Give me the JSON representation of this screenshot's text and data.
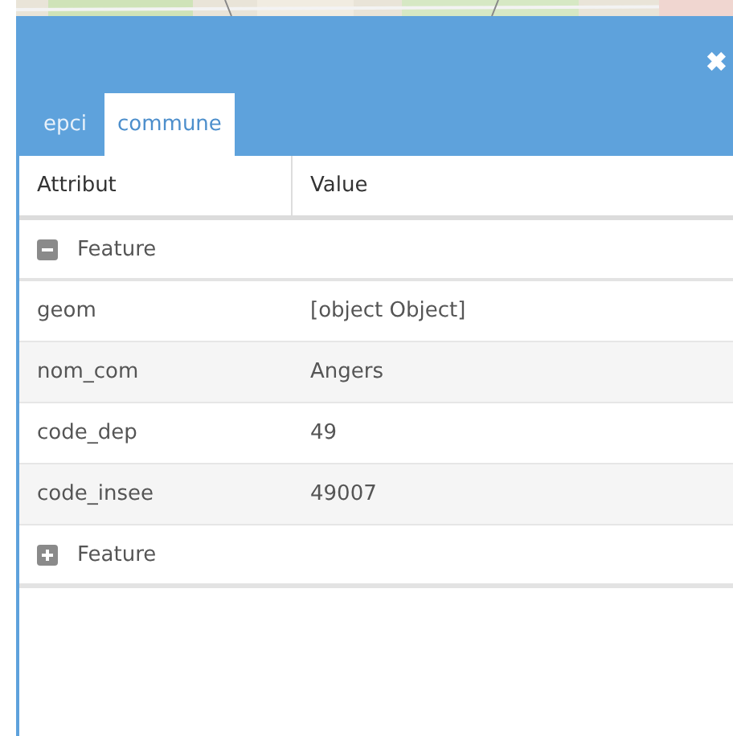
{
  "panel": {
    "close": "✖",
    "tabs": [
      {
        "label": "epci",
        "selected": false
      },
      {
        "label": "commune",
        "selected": true
      }
    ],
    "table": {
      "columns": [
        "Attribut",
        "Value"
      ],
      "features": [
        {
          "label": "Feature",
          "expanded": true,
          "rows": [
            {
              "attribute": "geom",
              "value": "[object Object]"
            },
            {
              "attribute": "nom_com",
              "value": "Angers"
            },
            {
              "attribute": "code_dep",
              "value": "49"
            },
            {
              "attribute": "code_insee",
              "value": "49007"
            }
          ]
        },
        {
          "label": "Feature",
          "expanded": false
        }
      ]
    }
  }
}
